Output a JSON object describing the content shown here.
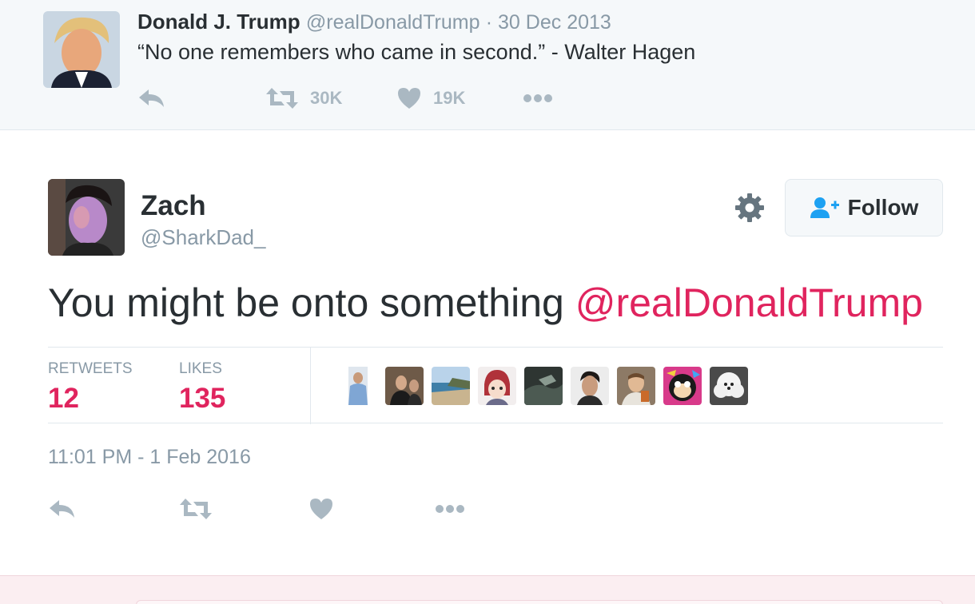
{
  "parent_tweet": {
    "name": "Donald J. Trump",
    "handle": "@realDonaldTrump",
    "date": "30 Dec 2013",
    "text": "“No one remembers who came in second.” -  Walter Hagen",
    "retweets": "30K",
    "likes": "19K"
  },
  "tweet": {
    "name": "Zach",
    "handle": "@SharkDad_",
    "text_prefix": "You might be onto something ",
    "mention": "@realDonaldTrump",
    "follow_label": "Follow",
    "retweets_label": "RETWEETS",
    "retweets_count": "12",
    "likes_label": "LIKES",
    "likes_count": "135",
    "timestamp": "11:01 PM - 1 Feb 2016",
    "liker_count": 9
  },
  "colors": {
    "accent": "#e0245e",
    "muted": "#8899a6",
    "icon": "#aab8c2",
    "follow_icon": "#1da1f2"
  },
  "icons": [
    "reply-icon",
    "retweet-icon",
    "heart-icon",
    "more-icon",
    "gear-icon",
    "follow-user-icon"
  ]
}
